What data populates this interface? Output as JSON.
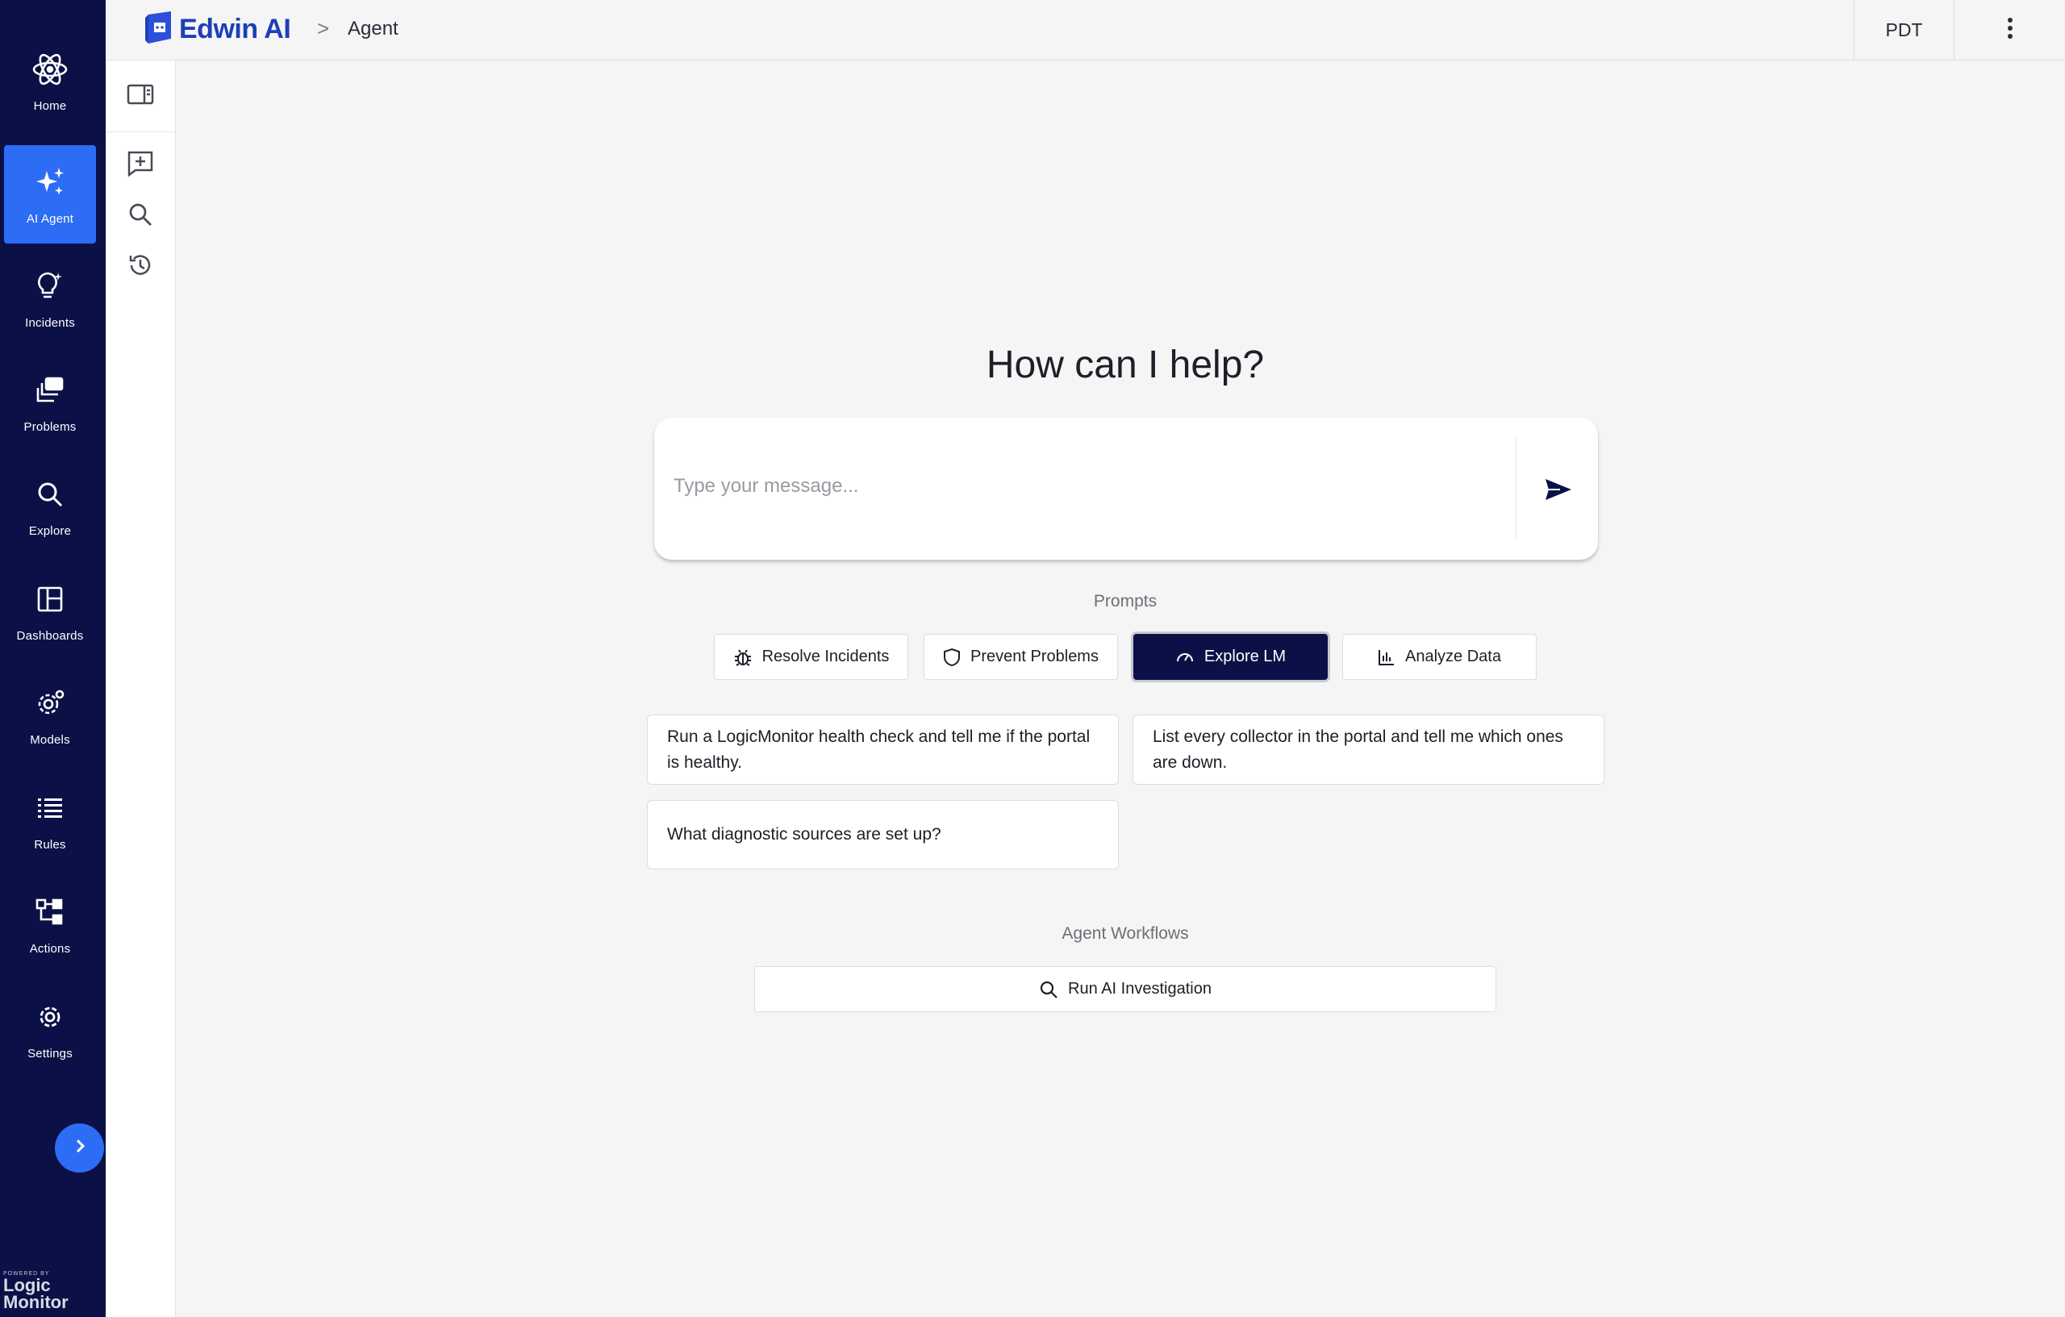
{
  "nav": {
    "items": [
      {
        "label": "Home",
        "icon": "atom-icon"
      },
      {
        "label": "AI Agent",
        "icon": "sparkles-icon"
      },
      {
        "label": "Incidents",
        "icon": "lightbulb-icon"
      },
      {
        "label": "Problems",
        "icon": "stacked-windows-icon"
      },
      {
        "label": "Explore",
        "icon": "search-icon"
      },
      {
        "label": "Dashboards",
        "icon": "dashboard-layout-icon"
      },
      {
        "label": "Models",
        "icon": "gear-cog-icon"
      },
      {
        "label": "Rules",
        "icon": "list-icon"
      },
      {
        "label": "Actions",
        "icon": "workflow-icon"
      },
      {
        "label": "Settings",
        "icon": "settings-icon"
      }
    ],
    "active": "AI Agent",
    "powered_small": "POWERED BY",
    "powered_brand_line1": "Logic",
    "powered_brand_line2": "Monitor"
  },
  "header": {
    "logo_text": "Edwin AI",
    "breadcrumb_sep": ">",
    "breadcrumb": "Agent",
    "timezone": "PDT"
  },
  "main": {
    "title": "How can I help?",
    "input_placeholder": "Type your message...",
    "prompts_label": "Prompts",
    "prompt_tabs": [
      {
        "label": "Resolve Incidents",
        "icon": "bug-icon"
      },
      {
        "label": "Prevent Problems",
        "icon": "shield-icon"
      },
      {
        "label": "Explore LM",
        "icon": "gauge-icon"
      },
      {
        "label": "Analyze Data",
        "icon": "bar-chart-icon"
      }
    ],
    "active_prompt_tab": "Explore LM",
    "suggestions": [
      "Run a LogicMonitor health check and tell me if the portal is healthy.",
      "List every collector in the portal and tell me which ones are down.",
      "What diagnostic sources are set up?"
    ],
    "workflows_label": "Agent Workflows",
    "workflow_button": "Run AI Investigation"
  },
  "colors": {
    "nav_bg": "#0b1146",
    "accent": "#2d6cf4",
    "brand": "#1d3fb8",
    "page_bg": "#f5f5f5"
  }
}
